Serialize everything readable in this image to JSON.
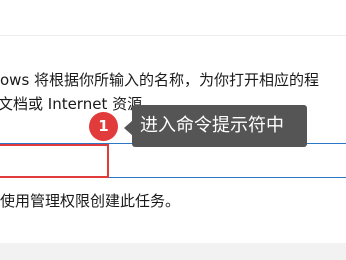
{
  "dialog": {
    "description_line1": "ows 将根据你所输入的名称，为你打开相应的程",
    "description_line2": "文档或 Internet 资源。",
    "open_field_value": "",
    "admin_note": "使用管理权限创建此任务。"
  },
  "annotation": {
    "step_number": "1",
    "tooltip_text": "进入命令提示符中",
    "badge_color": "#e23b3b",
    "tooltip_color": "#555555",
    "highlight_color": "#e23b3b"
  },
  "colors": {
    "input_border": "#2b78c7",
    "bottom_panel": "#f2f2f2"
  }
}
